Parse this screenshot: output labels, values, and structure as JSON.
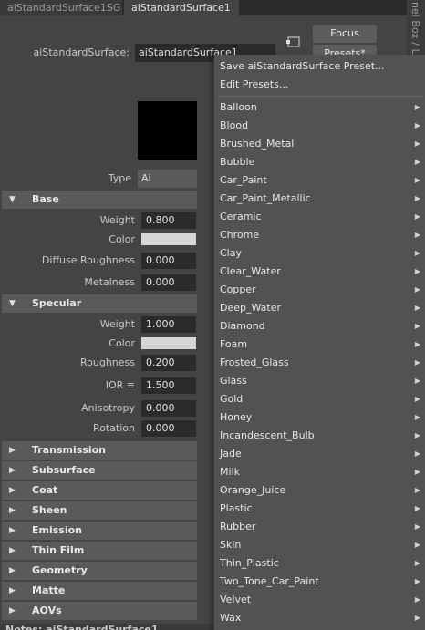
{
  "tabs": [
    {
      "label": "aiStandardSurface1SG"
    },
    {
      "label": "aiStandardSurface1"
    }
  ],
  "side_panel_text": "nel Box / La",
  "header": {
    "node_label": "aiStandardSurface:",
    "node_name": "aiStandardSurface1",
    "focus_label": "Focus",
    "presets_label": "Presets*"
  },
  "type_row": {
    "label": "Type",
    "value": "Ai Standard"
  },
  "base": {
    "title": "Base",
    "weight_label": "Weight",
    "weight_value": "0.800",
    "color_label": "Color",
    "diffuse_roughness_label": "Diffuse Roughness",
    "diffuse_roughness_value": "0.000",
    "metalness_label": "Metalness",
    "metalness_value": "0.000"
  },
  "specular": {
    "title": "Specular",
    "weight_label": "Weight",
    "weight_value": "1.000",
    "color_label": "Color",
    "roughness_label": "Roughness",
    "roughness_value": "0.200",
    "ior_label": "IOR ≡",
    "ior_value": "1.500",
    "anisotropy_label": "Anisotropy",
    "anisotropy_value": "0.000",
    "rotation_label": "Rotation",
    "rotation_value": "0.000"
  },
  "collapsed_sections": [
    "Transmission",
    "Subsurface",
    "Coat",
    "Sheen",
    "Emission",
    "Thin Film",
    "Geometry",
    "Matte",
    "AOVs"
  ],
  "footer_text": "Notes: aiStandardSurface1",
  "menu": {
    "save_preset": "Save aiStandardSurface Preset...",
    "edit_presets": "Edit Presets...",
    "presets": [
      "Balloon",
      "Blood",
      "Brushed_Metal",
      "Bubble",
      "Car_Paint",
      "Car_Paint_Metallic",
      "Ceramic",
      "Chrome",
      "Clay",
      "Clear_Water",
      "Copper",
      "Deep_Water",
      "Diamond",
      "Foam",
      "Frosted_Glass",
      "Glass",
      "Gold",
      "Honey",
      "Incandescent_Bulb",
      "Jade",
      "Milk",
      "Orange_Juice",
      "Plastic",
      "Rubber",
      "Skin",
      "Thin_Plastic",
      "Two_Tone_Car_Paint",
      "Velvet",
      "Wax"
    ]
  },
  "colors": {
    "base_color": "#d6d6d6",
    "specular_color": "#d6d6d6",
    "swatch_preview": "#000000"
  }
}
